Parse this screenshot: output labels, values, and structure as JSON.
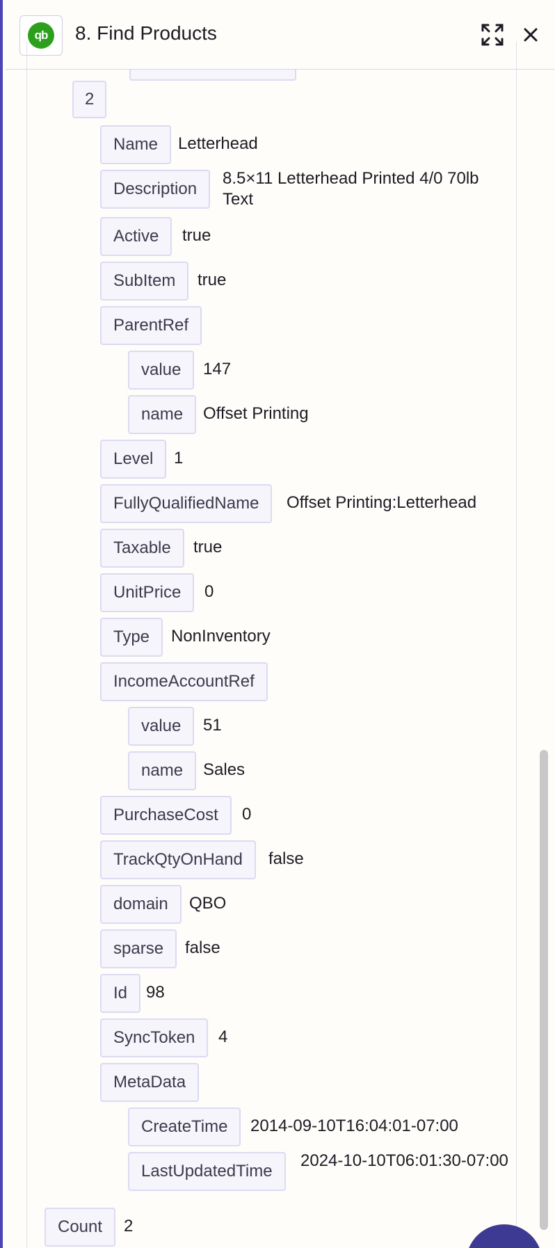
{
  "header": {
    "app_logo_text": "qb",
    "title": "8. Find Products"
  },
  "item": {
    "index": "2",
    "fields": [
      {
        "key": "Name",
        "value": "Letterhead"
      },
      {
        "key": "Description",
        "value": "8.5×11 Letterhead Printed 4/0 70lb Text"
      },
      {
        "key": "Active",
        "value": "true"
      },
      {
        "key": "SubItem",
        "value": "true"
      },
      {
        "key": "ParentRef",
        "value": ""
      },
      {
        "key": "value",
        "value": "147"
      },
      {
        "key": "name",
        "value": "Offset Printing"
      },
      {
        "key": "Level",
        "value": "1"
      },
      {
        "key": "FullyQualifiedName",
        "value": "Offset Printing:Letterhead"
      },
      {
        "key": "Taxable",
        "value": "true"
      },
      {
        "key": "UnitPrice",
        "value": "0"
      },
      {
        "key": "Type",
        "value": "NonInventory"
      },
      {
        "key": "IncomeAccountRef",
        "value": ""
      },
      {
        "key": "value",
        "value": "51"
      },
      {
        "key": "name",
        "value": "Sales"
      },
      {
        "key": "PurchaseCost",
        "value": "0"
      },
      {
        "key": "TrackQtyOnHand",
        "value": "false"
      },
      {
        "key": "domain",
        "value": "QBO"
      },
      {
        "key": "sparse",
        "value": "false"
      },
      {
        "key": "Id",
        "value": "98"
      },
      {
        "key": "SyncToken",
        "value": "4"
      },
      {
        "key": "MetaData",
        "value": ""
      },
      {
        "key": "CreateTime",
        "value": "2014-09-10T16:04:01-07:00"
      },
      {
        "key": "LastUpdatedTime",
        "value": "2024-10-10T06:01:30-07:00"
      }
    ]
  },
  "count": {
    "key": "Count",
    "value": "2"
  },
  "icons": {
    "expand": "expand-icon",
    "close": "close-icon"
  }
}
